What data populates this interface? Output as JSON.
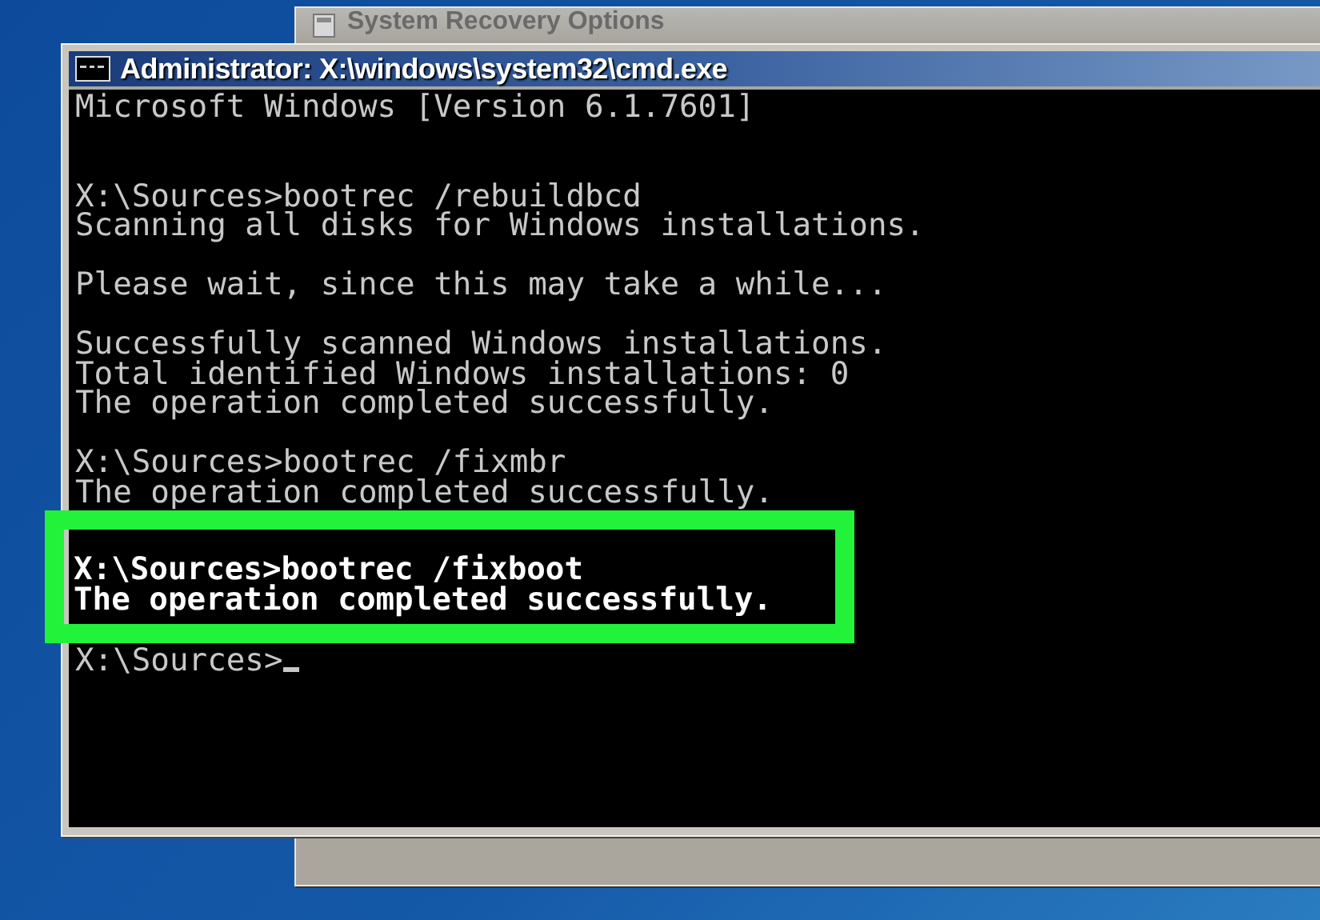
{
  "background_window": {
    "title": "System Recovery Options"
  },
  "cmd_window": {
    "title": "Administrator: X:\\windows\\system32\\cmd.exe"
  },
  "console": {
    "header": "Microsoft Windows [Version 6.1.7601]",
    "groups": [
      {
        "highlighted": false,
        "lines": [
          "X:\\Sources>bootrec /rebuildbcd",
          "Scanning all disks for Windows installations."
        ]
      },
      {
        "highlighted": false,
        "lines": [
          "Please wait, since this may take a while..."
        ]
      },
      {
        "highlighted": false,
        "lines": [
          "Successfully scanned Windows installations.",
          "Total identified Windows installations: 0",
          "The operation completed successfully."
        ]
      },
      {
        "highlighted": false,
        "lines": [
          "X:\\Sources>bootrec /fixmbr",
          "The operation completed successfully."
        ]
      },
      {
        "highlighted": true,
        "lines": [
          "X:\\Sources>bootrec /fixboot",
          "The operation completed successfully."
        ]
      }
    ],
    "prompt": "X:\\Sources>"
  }
}
